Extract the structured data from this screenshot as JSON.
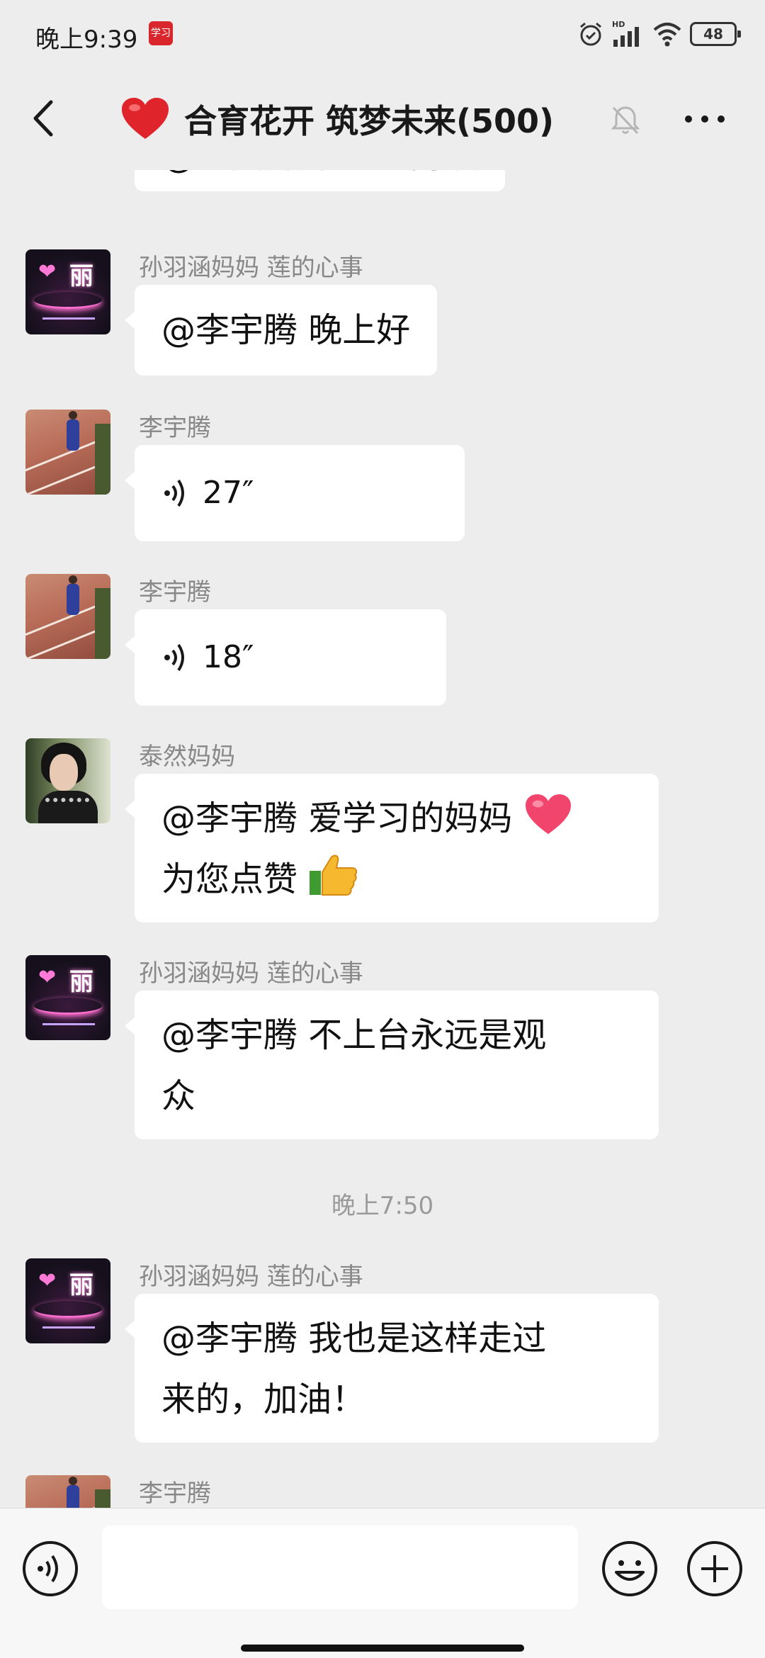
{
  "status_bar": {
    "time": "晚上9:39",
    "app_icon_text": "学习",
    "network": "HD",
    "battery": "48"
  },
  "header": {
    "title": "合育花开 筑梦未来(500)"
  },
  "messages": [
    {
      "sender": "",
      "text": "@泰然妈妈  谢谢阿姨"
    },
    {
      "sender": "孙羽涵妈妈  莲的心事",
      "text": "@李宇腾  晚上好"
    },
    {
      "sender": "李宇腾",
      "voice_duration": "27″"
    },
    {
      "sender": "李宇腾",
      "voice_duration": "18″"
    },
    {
      "sender": "泰然妈妈",
      "line1": "@李宇腾  爱学习的妈妈",
      "line2": "为您点赞"
    },
    {
      "sender": "孙羽涵妈妈  莲的心事",
      "line1": "@李宇腾  不上台永远是观",
      "line2": "众"
    },
    {
      "sender": "孙羽涵妈妈  莲的心事",
      "line1": "@李宇腾  我也是这样走过",
      "line2": "来的，加油！"
    },
    {
      "sender": "李宇腾"
    }
  ],
  "time_divider": "晚上7:50",
  "avatar_text": {
    "rose_char": "丽"
  },
  "input": {
    "placeholder": ""
  },
  "colors": {
    "background": "#ededed",
    "bubble": "#ffffff",
    "sender_text": "#888888"
  }
}
